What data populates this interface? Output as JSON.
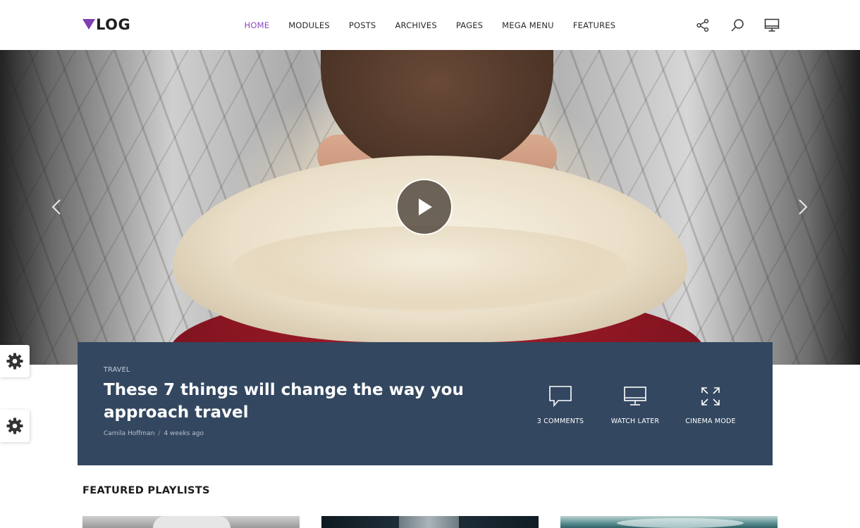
{
  "header": {
    "logo": "LOG",
    "nav": [
      {
        "label": "HOME",
        "active": true
      },
      {
        "label": "MODULES",
        "active": false
      },
      {
        "label": "POSTS",
        "active": false
      },
      {
        "label": "ARCHIVES",
        "active": false
      },
      {
        "label": "PAGES",
        "active": false
      },
      {
        "label": "MEGA MENU",
        "active": false
      },
      {
        "label": "FEATURES",
        "active": false
      }
    ],
    "icons": [
      "share-icon",
      "search-icon",
      "monitor-icon"
    ],
    "accent_color": "#8d48c2"
  },
  "hero": {
    "play_icon": "play-icon",
    "prev_icon": "chevron-left-icon",
    "next_icon": "chevron-right-icon"
  },
  "post": {
    "category": "TRAVEL",
    "title": "These 7 things will change the way you approach travel",
    "author": "Camila Hoffman",
    "separator": "/",
    "time": "4 weeks ago",
    "panel_color": "#334760",
    "actions": [
      {
        "label": "3 COMMENTS",
        "icon": "comment-icon"
      },
      {
        "label": "WATCH LATER",
        "icon": "monitor-icon"
      },
      {
        "label": "CINEMA MODE",
        "icon": "expand-icon"
      }
    ]
  },
  "sidebar": {
    "tabs": [
      "gear-icon",
      "gear-icon"
    ]
  },
  "featured": {
    "title": "FEATURED PLAYLISTS"
  }
}
